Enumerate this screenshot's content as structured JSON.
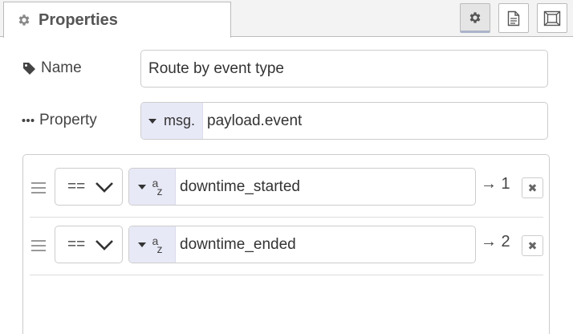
{
  "tabs": {
    "properties_label": "Properties",
    "buttons": [
      {
        "name": "settings-tab-button",
        "icon": "gear-icon",
        "selected": true
      },
      {
        "name": "description-tab-button",
        "icon": "document-icon",
        "selected": false
      },
      {
        "name": "appearance-tab-button",
        "icon": "frame-icon",
        "selected": false
      }
    ]
  },
  "form": {
    "name_label": "Name",
    "name_value": "Route by event type",
    "property_label": "Property",
    "property_type": "msg.",
    "property_value": "payload.event"
  },
  "rules": [
    {
      "operator": "==",
      "type_a": "a",
      "type_z": "z",
      "value": "downtime_started",
      "output": "→ 1"
    },
    {
      "operator": "==",
      "type_a": "a",
      "type_z": "z",
      "value": "downtime_ended",
      "output": "→ 2"
    }
  ],
  "remove_glyph": "✖",
  "colors": {
    "type_selector_bg": "#e8e9f7",
    "tab_bar_bg": "#f3f3f3",
    "border": "#cccccc"
  }
}
